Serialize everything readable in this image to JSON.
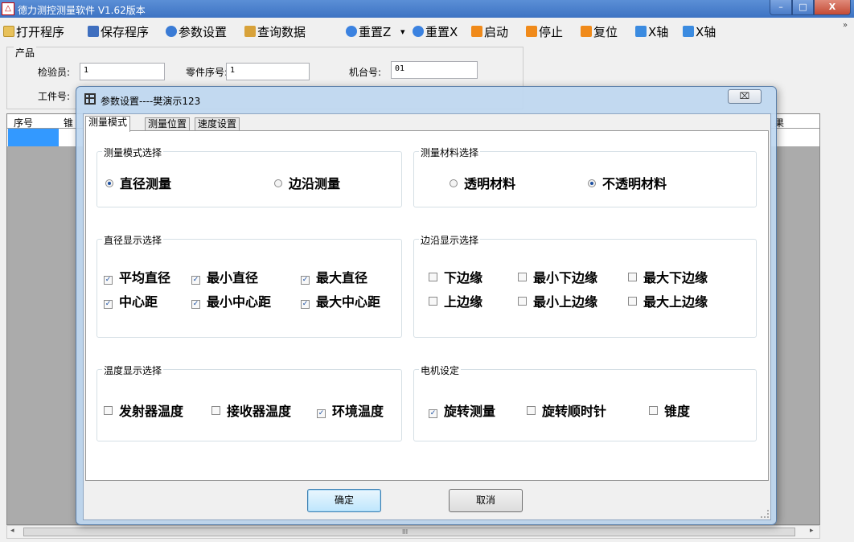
{
  "window": {
    "title": "德力测控测量软件 V1.62版本",
    "app_icon": "△",
    "minimize": "–",
    "maximize": "□",
    "close": "X"
  },
  "toolbar": {
    "open": "打开程序",
    "save": "保存程序",
    "settings": "参数设置",
    "query": "查询数据",
    "resetZ": "重置Z",
    "dropdown": "▾",
    "resetX": "重置X",
    "start": "启动",
    "stop": "停止",
    "home": "复位",
    "xleft": "X轴",
    "xright": "X轴",
    "more": "»"
  },
  "product": {
    "legend": "产品",
    "inspector_label": "检验员:",
    "inspector_value": "1",
    "part_no_label": "零件序号:",
    "part_no_value": "1",
    "machine_label": "机台号:",
    "machine_value": "01",
    "work_no_label": "工件号:"
  },
  "grid": {
    "col_seq": "序号",
    "col_cone": "锥",
    "col_result": "果"
  },
  "scroll": {
    "left": "◂",
    "right": "▸",
    "grip": "III"
  },
  "dialog": {
    "title": "参数设置----樊演示123",
    "close": "⌧",
    "tabs": [
      "测量模式",
      "测量位置",
      "速度设置"
    ],
    "mode_group": {
      "legend": "测量模式选择",
      "options": [
        "直径测量",
        "边沿测量"
      ],
      "selected": 0
    },
    "material_group": {
      "legend": "测量材料选择",
      "options": [
        "透明材料",
        "不透明材料"
      ],
      "selected": 1
    },
    "diameter_group": {
      "legend": "直径显示选择",
      "row1": [
        {
          "label": "平均直径",
          "checked": true
        },
        {
          "label": "最小直径",
          "checked": true
        },
        {
          "label": "最大直径",
          "checked": true
        }
      ],
      "row2": [
        {
          "label": "中心距",
          "checked": true
        },
        {
          "label": "最小中心距",
          "checked": true
        },
        {
          "label": "最大中心距",
          "checked": true
        }
      ]
    },
    "edge_group": {
      "legend": "边沿显示选择",
      "row1": [
        {
          "label": "下边缘",
          "checked": false
        },
        {
          "label": "最小下边缘",
          "checked": false
        },
        {
          "label": "最大下边缘",
          "checked": false
        }
      ],
      "row2": [
        {
          "label": "上边缘",
          "checked": false
        },
        {
          "label": "最小上边缘",
          "checked": false
        },
        {
          "label": "最大上边缘",
          "checked": false
        }
      ]
    },
    "temp_group": {
      "legend": "温度显示选择",
      "items": [
        {
          "label": "发射器温度",
          "checked": false
        },
        {
          "label": "接收器温度",
          "checked": false
        },
        {
          "label": "环境温度",
          "checked": true
        }
      ]
    },
    "motor_group": {
      "legend": "电机设定",
      "items": [
        {
          "label": "旋转测量",
          "checked": true
        },
        {
          "label": "旋转顺时针",
          "checked": false
        },
        {
          "label": "锥度",
          "checked": false
        }
      ]
    },
    "ok": "确定",
    "cancel": "取消"
  },
  "colors": {
    "title_bar": "#3d73c3",
    "selection": "#3399ff",
    "check": "#1c4fa0"
  },
  "icons": [
    "folder-icon",
    "save-icon",
    "gear-icon",
    "search-icon",
    "reset-icon",
    "play-icon",
    "stop-icon",
    "home-icon",
    "arrow-left-icon",
    "arrow-right-icon"
  ]
}
